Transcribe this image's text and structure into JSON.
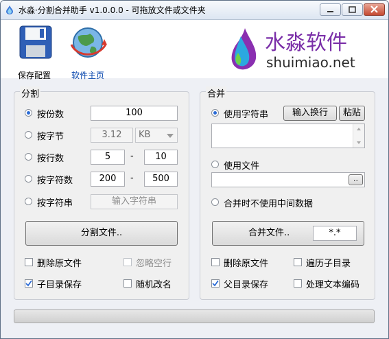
{
  "window": {
    "title": "水淼·分割合并助手 v1.0.0.0 - 可拖放文件或文件夹"
  },
  "toolbar": {
    "save_label": "保存配置",
    "home_label": "软件主页"
  },
  "brand": {
    "name": "水淼软件",
    "site": "shuimiao.net"
  },
  "split": {
    "title": "分割",
    "by_count": {
      "label": "按份数",
      "value": "100",
      "selected": true
    },
    "by_bytes": {
      "label": "按字节",
      "value": "3.12",
      "unit": "KB",
      "selected": false
    },
    "by_lines": {
      "label": "按行数",
      "from": "5",
      "to": "10",
      "selected": false
    },
    "by_chars": {
      "label": "按字符数",
      "from": "200",
      "to": "500",
      "selected": false
    },
    "by_string": {
      "label": "按字符串",
      "placeholder": "输入字符串",
      "selected": false
    },
    "dash": "-",
    "button": "分割文件..",
    "delete_original": {
      "label": "删除原文件",
      "checked": false
    },
    "ignore_empty": {
      "label": "忽略空行",
      "checked": false
    },
    "save_subdir": {
      "label": "子目录保存",
      "checked": true
    },
    "random_rename": {
      "label": "随机改名",
      "checked": false
    }
  },
  "merge": {
    "title": "合并",
    "use_string": {
      "label": "使用字符串",
      "selected": true
    },
    "input_newline_button": "输入换行",
    "paste_button": "粘贴",
    "use_file": {
      "label": "使用文件",
      "selected": false
    },
    "browse_button": "..",
    "no_intermediate": {
      "label": "合并时不使用中间数据",
      "selected": false
    },
    "button": "合并文件..",
    "pattern": "*.*",
    "delete_original": {
      "label": "删除原文件",
      "checked": false
    },
    "traverse_subdirs": {
      "label": "遍历子目录",
      "checked": false
    },
    "save_parent": {
      "label": "父目录保存",
      "checked": true
    },
    "process_encoding": {
      "label": "处理文本编码",
      "checked": false
    }
  },
  "progress": {
    "value": 0
  },
  "colors": {
    "accent": "#2a6bd6",
    "brand": "#7a2ea8",
    "brand_dark": "#2b2b2b"
  }
}
